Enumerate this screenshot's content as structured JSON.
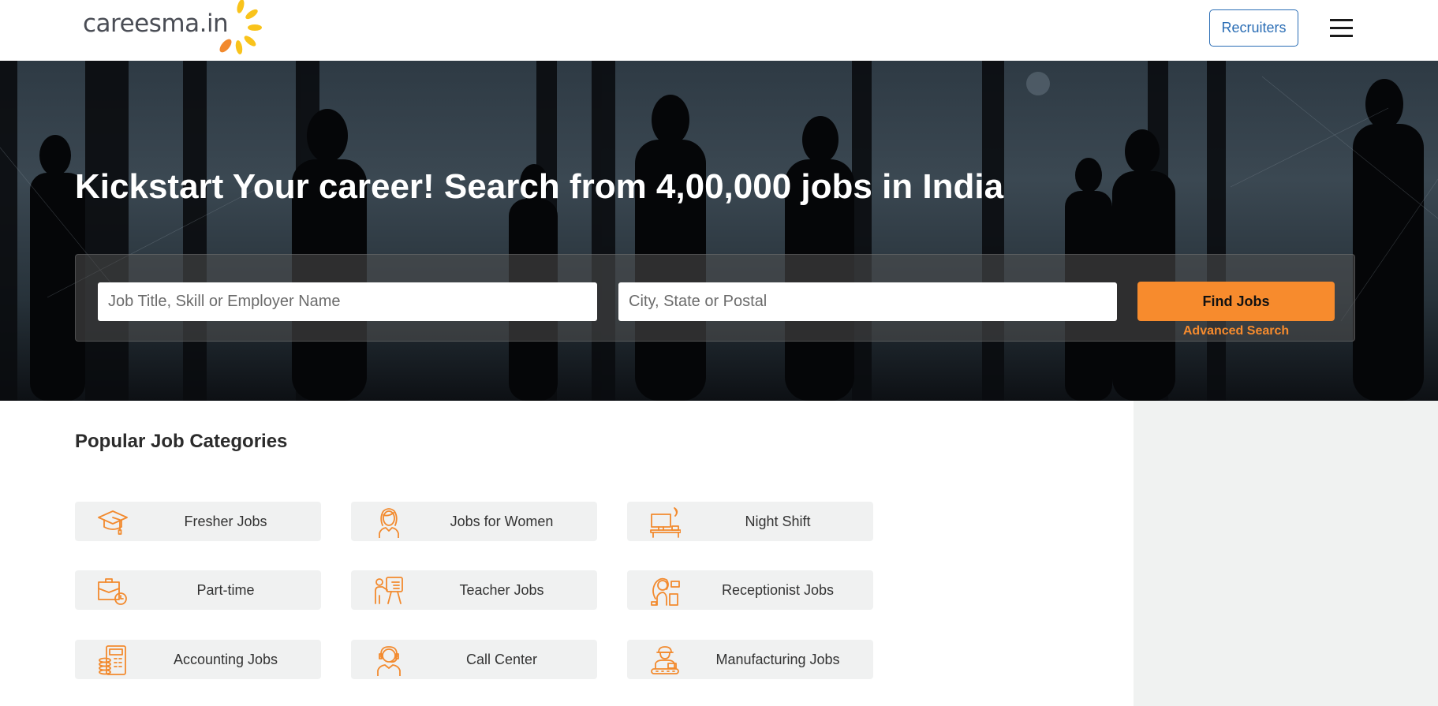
{
  "header": {
    "logo_text": "careesma.in",
    "recruiters_label": "Recruiters",
    "menu_icon": "hamburger-menu-icon"
  },
  "hero": {
    "title": "Kickstart Your career! Search from 4,00,000 jobs in India",
    "search": {
      "job_placeholder": "Job Title, Skill or Employer Name",
      "job_value": "",
      "location_placeholder": "City, State or Postal",
      "location_value": "",
      "find_label": "Find Jobs",
      "advanced_label": "Advanced Search"
    }
  },
  "categories": {
    "title": "Popular Job Categories",
    "items": [
      {
        "label": "Fresher Jobs",
        "icon": "graduation-cap-icon"
      },
      {
        "label": "Jobs for Women",
        "icon": "woman-icon"
      },
      {
        "label": "Night Shift",
        "icon": "night-desk-icon"
      },
      {
        "label": "Part-time",
        "icon": "briefcase-clock-icon"
      },
      {
        "label": "Teacher Jobs",
        "icon": "teacher-board-icon"
      },
      {
        "label": "Receptionist Jobs",
        "icon": "receptionist-icon"
      },
      {
        "label": "Accounting Jobs",
        "icon": "calculator-coins-icon"
      },
      {
        "label": "Call Center",
        "icon": "headset-agent-icon"
      },
      {
        "label": "Manufacturing Jobs",
        "icon": "factory-worker-icon"
      }
    ]
  },
  "colors": {
    "accent": "#f78b2d",
    "link_blue": "#2a6db5",
    "card_bg": "#f0f1f1",
    "side_panel_bg": "#f0f2f1"
  }
}
